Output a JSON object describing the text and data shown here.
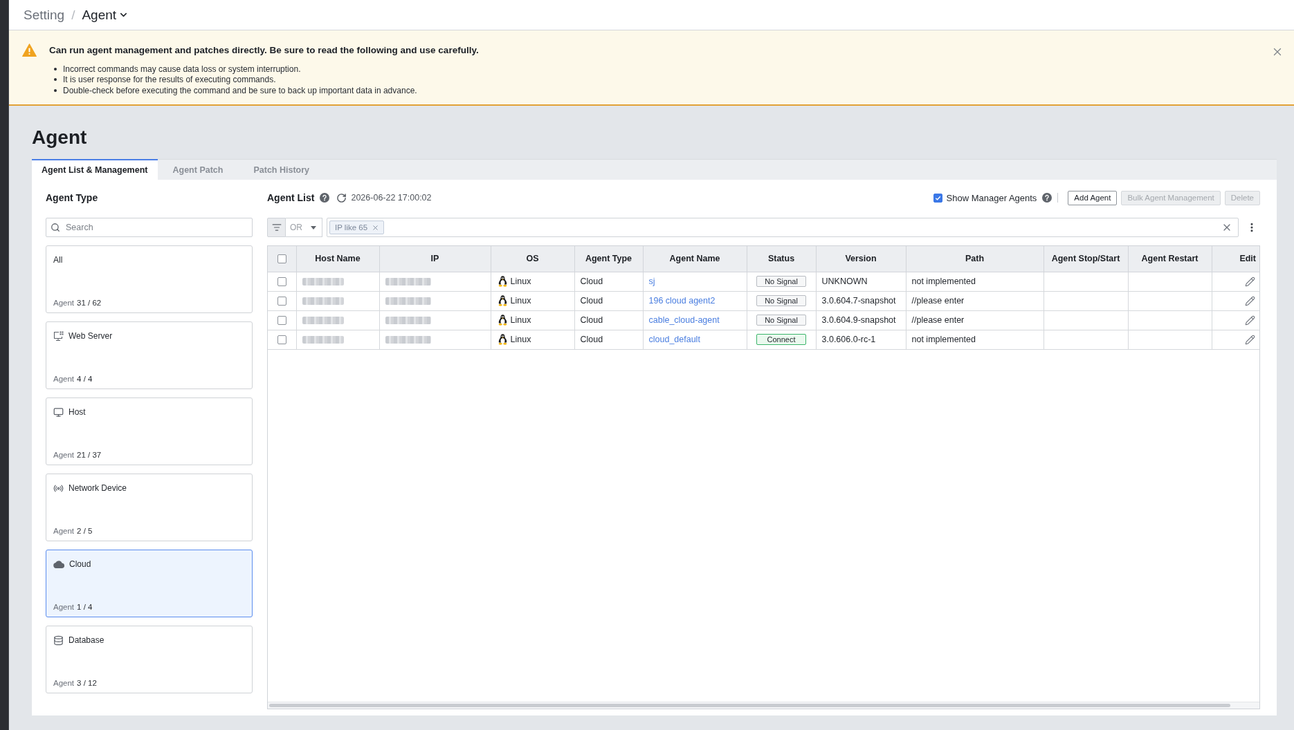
{
  "breadcrumb": {
    "separator": "/",
    "items": [
      {
        "label": "Setting",
        "kind": "link"
      },
      {
        "label": "Agent",
        "kind": "dropdown"
      }
    ]
  },
  "notice": {
    "title": "Can run agent management and patches directly. Be sure to read the following and use carefully.",
    "items": [
      "Incorrect commands may cause data loss or system interruption.",
      "It is user response for the results of executing commands.",
      "Double-check before executing the command and be sure to back up important data in advance."
    ]
  },
  "page_title": "Agent",
  "tabs": [
    {
      "label": "Agent List & Management",
      "selected": true
    },
    {
      "label": "Agent Patch",
      "selected": false
    },
    {
      "label": "Patch History",
      "selected": false
    }
  ],
  "agent_type_panel": {
    "title": "Agent Type",
    "search": {
      "placeholder": "Search"
    },
    "types": [
      {
        "kind": "all",
        "name": "All",
        "count_label": "Agent",
        "count": "31 / 62",
        "selected": false
      },
      {
        "kind": "web_server",
        "name": "Web Server",
        "count_label": "Agent",
        "count": "4 / 4",
        "selected": false
      },
      {
        "kind": "host",
        "name": "Host",
        "count_label": "Agent",
        "count": "21 / 37",
        "selected": false
      },
      {
        "kind": "network_device",
        "name": "Network Device",
        "count_label": "Agent",
        "count": "2 / 5",
        "selected": false
      },
      {
        "kind": "cloud",
        "name": "Cloud",
        "count_label": "Agent",
        "count": "1 / 4",
        "selected": true
      },
      {
        "kind": "database",
        "name": "Database",
        "count_label": "Agent",
        "count": "3 / 12",
        "selected": false
      }
    ]
  },
  "agent_list": {
    "title": "Agent List",
    "updated_at": "2026-06-22 17:00:02",
    "show_manager_agents": {
      "label": "Show Manager Agents",
      "checked": true
    },
    "buttons": [
      {
        "label": "Add Agent",
        "disabled": false
      },
      {
        "label": "Bulk Agent Management",
        "disabled": true
      },
      {
        "label": "Delete",
        "disabled": true
      }
    ],
    "filter": {
      "operator": "OR",
      "chips": [
        "IP like 65"
      ]
    },
    "table": {
      "select_all_checked": false,
      "columns": [
        "Host Name",
        "IP",
        "OS",
        "Agent Type",
        "Agent Name",
        "Status",
        "Version",
        "Path",
        "Agent Stop/Start",
        "Agent Restart",
        "Edit"
      ],
      "rows": [
        {
          "checked": false,
          "os": {
            "name": "Linux",
            "kind": "linux"
          },
          "agent_type": "Cloud",
          "agent_name": "sj",
          "status": {
            "label": "No Signal",
            "kind": "offline"
          },
          "version": "UNKNOWN",
          "path": "not implemented"
        },
        {
          "checked": false,
          "os": {
            "name": "Linux",
            "kind": "linux"
          },
          "agent_type": "Cloud",
          "agent_name": "196 cloud agent2",
          "status": {
            "label": "No Signal",
            "kind": "offline"
          },
          "version": "3.0.604.7-snapshot",
          "path": "//please enter"
        },
        {
          "checked": false,
          "os": {
            "name": "Linux",
            "kind": "linux"
          },
          "agent_type": "Cloud",
          "agent_name": "cable_cloud-agent",
          "status": {
            "label": "No Signal",
            "kind": "offline"
          },
          "version": "3.0.604.9-snapshot",
          "path": "//please enter"
        },
        {
          "checked": false,
          "os": {
            "name": "Linux",
            "kind": "linux"
          },
          "agent_type": "Cloud",
          "agent_name": "cloud_default",
          "status": {
            "label": "Connect",
            "kind": "online"
          },
          "version": "3.0.606.0-rc-1",
          "path": "not implemented"
        }
      ]
    }
  }
}
